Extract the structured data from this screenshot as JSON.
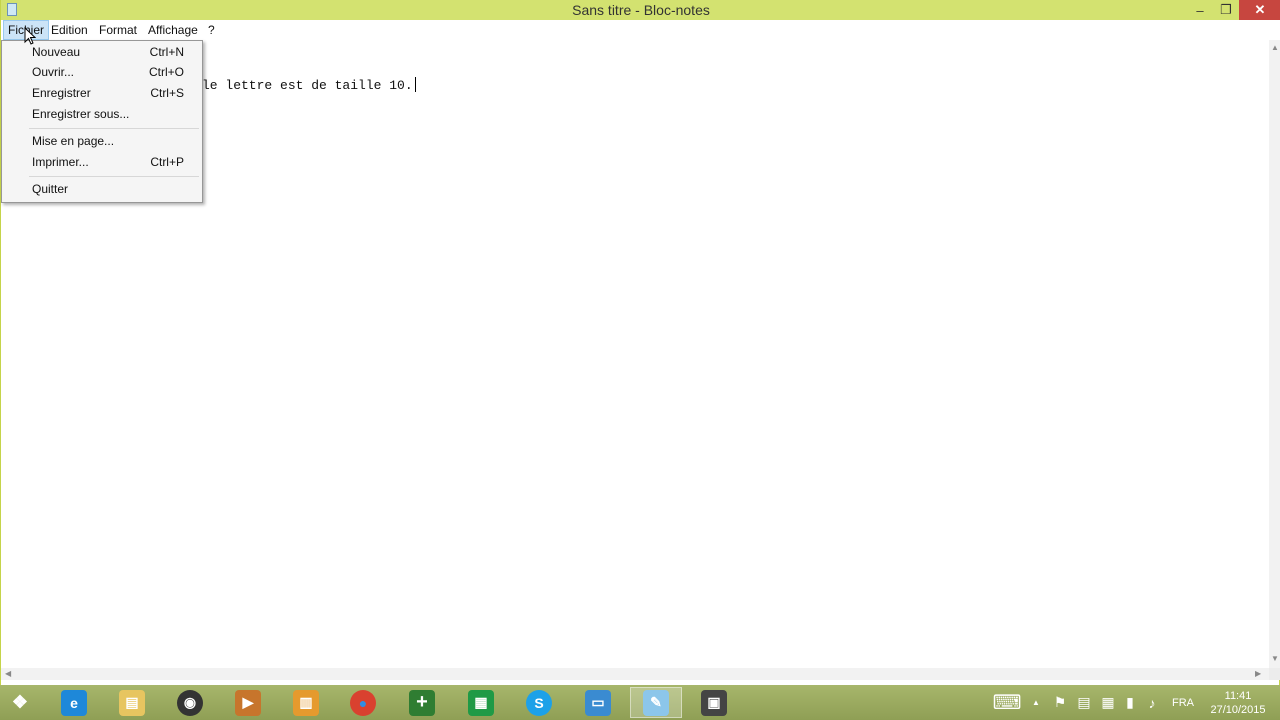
{
  "window": {
    "title": "Sans titre - Bloc-notes",
    "minimize_glyph": "–",
    "restore_glyph": "❐",
    "close_glyph": "✕"
  },
  "menubar": {
    "items": [
      "Fichier",
      "Edition",
      "Format",
      "Affichage",
      "?"
    ]
  },
  "file_menu": {
    "items": [
      {
        "label": "Nouveau",
        "shortcut": "Ctrl+N"
      },
      {
        "label": "Ouvrir...",
        "shortcut": "Ctrl+O"
      },
      {
        "label": "Enregistrer",
        "shortcut": "Ctrl+S"
      },
      {
        "label": "Enregistrer sous...",
        "shortcut": ""
      },
      {
        "label": "Mise en page...",
        "shortcut": ""
      },
      {
        "label": "Imprimer...",
        "shortcut": "Ctrl+P"
      },
      {
        "label": "Quitter",
        "shortcut": ""
      }
    ]
  },
  "editor": {
    "visible_text": "le lettre est de taille 10."
  },
  "taskbar": {
    "apps": [
      {
        "name": "start-icon",
        "glyph": "❖",
        "color": "transparent"
      },
      {
        "name": "internet-explorer-icon",
        "glyph": "e",
        "color": "#1e88d9"
      },
      {
        "name": "file-explorer-icon",
        "glyph": "▤",
        "color": "#e7c560"
      },
      {
        "name": "media-speaker-icon",
        "glyph": "◉",
        "color": "#333333"
      },
      {
        "name": "media-player-icon",
        "glyph": "▶",
        "color": "#c7752c"
      },
      {
        "name": "archive-icon",
        "glyph": "▥",
        "color": "#e59a2e"
      },
      {
        "name": "chrome-icon",
        "glyph": "●",
        "color": "#d9412f"
      },
      {
        "name": "game-add-icon",
        "glyph": "+",
        "color": "#2f7d32"
      },
      {
        "name": "store-icon",
        "glyph": "▦",
        "color": "#1f9a46"
      },
      {
        "name": "skype-icon",
        "glyph": "S",
        "color": "#1da1e8"
      },
      {
        "name": "desktop-icon",
        "glyph": "▭",
        "color": "#3a8bd1"
      },
      {
        "name": "notepad-icon",
        "glyph": "✎",
        "color": "#8cc6ea"
      },
      {
        "name": "video-camera-icon",
        "glyph": "▣",
        "color": "#444444"
      }
    ],
    "tray": {
      "keyboard_glyph": "⌨",
      "show_hidden_glyph": "▲",
      "language": "FRA",
      "time": "11:41",
      "date": "27/10/2015"
    }
  }
}
